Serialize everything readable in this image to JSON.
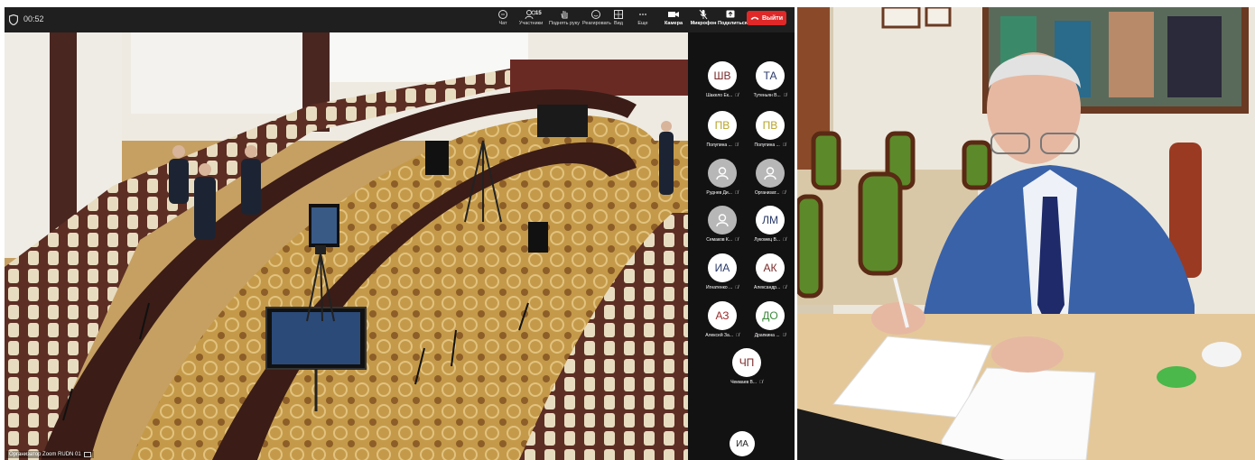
{
  "toolbar": {
    "timer": "00:52",
    "chat": "Чат",
    "participants": "Участники",
    "participants_count": "15",
    "raise_hand": "Поднять руку",
    "react": "Реагировать",
    "view": "Вид",
    "more": "Еще",
    "camera": "Камера",
    "microphone": "Микрофон",
    "share": "Поделиться",
    "leave": "Выйти"
  },
  "video": {
    "label": "Организатор Zoom RUDN 01"
  },
  "participants": [
    {
      "initials": "ШВ",
      "name": "Шакело Ек...",
      "color": "#7a2a2a"
    },
    {
      "initials": "ТА",
      "name": "Тутеньян В...",
      "color": "#2a3a6a"
    },
    {
      "initials": "ПВ",
      "name": "Полупина ...",
      "color": "#b8a428"
    },
    {
      "initials": "ПВ",
      "name": "Полупина ...",
      "color": "#b8a428"
    },
    {
      "initials": "",
      "name": "Руднев Ди...",
      "color": "#ffffff"
    },
    {
      "initials": "",
      "name": "Организат...",
      "color": "#ffffff"
    },
    {
      "initials": "",
      "name": "Семаков К...",
      "color": "#ffffff"
    },
    {
      "initials": "ЛМ",
      "name": "Лукомец В...",
      "color": "#2a3a6a"
    },
    {
      "initials": "ИА",
      "name": "Игнатенко ...",
      "color": "#2a3a6a"
    },
    {
      "initials": "АК",
      "name": "Александр...",
      "color": "#7a2a2a"
    },
    {
      "initials": "АЗ",
      "name": "Алексей За...",
      "color": "#9a2a2a"
    },
    {
      "initials": "ДО",
      "name": "Драпкина ...",
      "color": "#3a8a3a"
    },
    {
      "initials": "ЧП",
      "name": "Чекмаев В...",
      "color": "#7a2a2a"
    }
  ],
  "self": {
    "initials": "ИА"
  },
  "colors": {
    "leave": "#e02828",
    "toolbar_bg": "#1f1f1f",
    "panel_bg": "#121212"
  }
}
